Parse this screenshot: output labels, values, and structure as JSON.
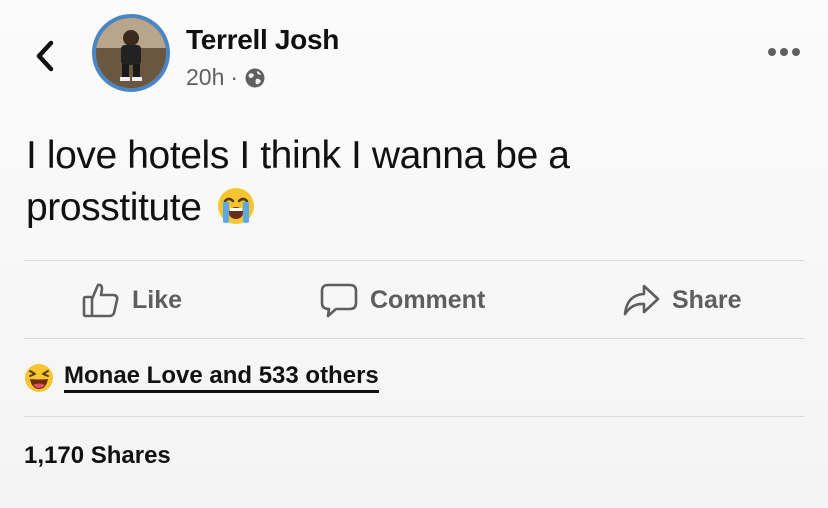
{
  "post": {
    "author_name": "Terrell Josh",
    "timestamp": "20h",
    "separator": "·",
    "privacy_icon": "globe-icon",
    "text": "I love hotels I think I wanna be a prosstitute",
    "text_emoji": "loudly-crying-face-icon"
  },
  "nav": {
    "back_icon": "chevron-left-icon",
    "more_icon": "more-horizontal-icon"
  },
  "actions": [
    {
      "label": "Like",
      "icon": "thumbs-up-icon"
    },
    {
      "label": "Comment",
      "icon": "comment-bubble-icon"
    },
    {
      "label": "Share",
      "icon": "share-arrow-icon"
    }
  ],
  "reactions": {
    "icon": "haha-reaction-icon",
    "summary": "Monae Love and 533 others"
  },
  "shares": {
    "label": "1,170 Shares"
  },
  "colors": {
    "avatar_ring": "#4a86c5",
    "text": "#111111",
    "muted": "#5e5e5e",
    "divider": "#d9d9d9"
  }
}
